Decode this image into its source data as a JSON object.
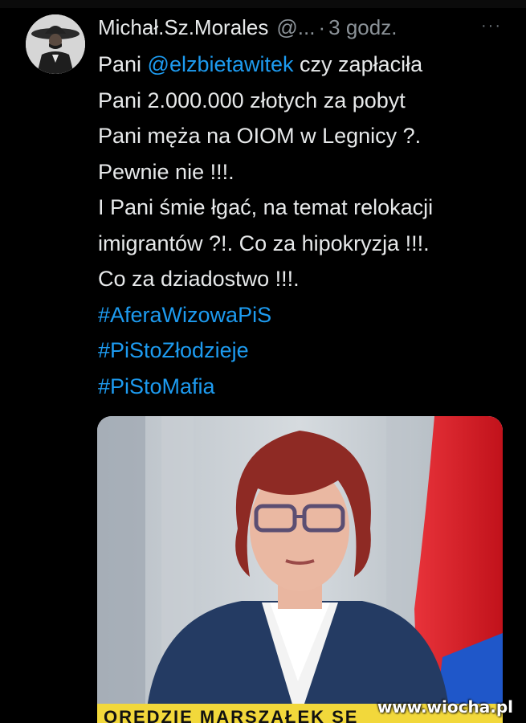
{
  "tweet": {
    "author_name": "Michał.Sz.Morales",
    "handle": "@...",
    "separator": "·",
    "time": "3 godz.",
    "more_label": "···",
    "body_lines": [
      [
        {
          "text": "Pani "
        },
        {
          "text": "@elzbietawitek",
          "type": "mention"
        },
        {
          "text": " czy zapłaciła"
        }
      ],
      [
        {
          "text": "Pani 2.000.000 złotych za pobyt"
        }
      ],
      [
        {
          "text": "Pani męża na OIOM w Legnicy ?."
        }
      ],
      [
        {
          "text": "Pewnie nie !!!."
        }
      ],
      [
        {
          "text": "I Pani śmie łgać, na temat relokacji"
        }
      ],
      [
        {
          "text": "imigrantów ?!. Co za  hipokryzja !!!."
        }
      ],
      [
        {
          "text": "Co za dziadostwo !!!."
        }
      ],
      [
        {
          "text": "#AferaWizowaPiS",
          "type": "hashtag"
        }
      ],
      [
        {
          "text": "#PiStoZłodzieje",
          "type": "hashtag"
        }
      ],
      [
        {
          "text": "#PiStoMafia",
          "type": "hashtag"
        }
      ]
    ]
  },
  "media": {
    "kind": "photo",
    "banner_text": "ORĘDZIE MARSZAŁEK SE"
  },
  "watermark": "www.wiocha.pl",
  "colors": {
    "background": "#000000",
    "text": "#e7e9ea",
    "link": "#1d9bf0",
    "muted": "#8b9298"
  }
}
